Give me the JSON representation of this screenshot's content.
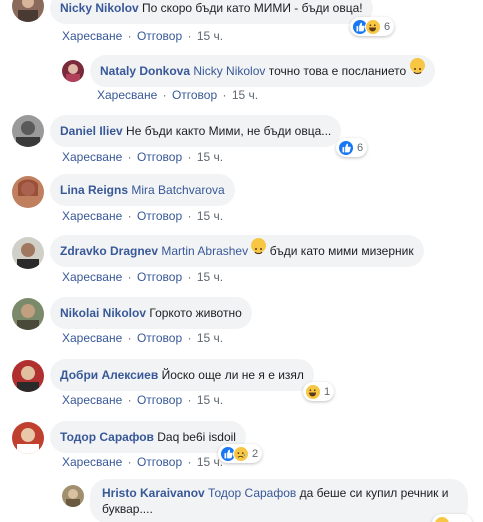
{
  "labels": {
    "like": "Харесване",
    "reply": "Отговор",
    "sep": "·"
  },
  "comments": [
    {
      "author": "Nicky Nikolov",
      "mention": "",
      "text": "По скоро бъди като МИМИ - бъди овца!",
      "time": "15 ч.",
      "reaction_count": "6"
    },
    {
      "author": "Nataly Donkova",
      "mention": "Nicky Nikolov",
      "text": "точно това е посланието",
      "time": "15 ч.",
      "reaction_count": ""
    },
    {
      "author": "Daniel Iliev",
      "mention": "",
      "text": "Не бъди както Мими, не бъди овца...",
      "time": "15 ч.",
      "reaction_count": "6"
    },
    {
      "author": "Lina Reigns",
      "mention": "Mira Batchvarova",
      "text": "",
      "time": "15 ч.",
      "reaction_count": ""
    },
    {
      "author": "Zdravko Dragnev",
      "mention": "Martin Abrashev",
      "text": "бъди като мими мизерник",
      "time": "15 ч.",
      "reaction_count": ""
    },
    {
      "author": "Nikolai Nikolov",
      "mention": "",
      "text": "Горкото животно",
      "time": "15 ч.",
      "reaction_count": ""
    },
    {
      "author": "Добри Алексиев",
      "mention": "",
      "text": "Йоско още ли не я е изял",
      "time": "15 ч.",
      "reaction_count": "1"
    },
    {
      "author": "Тодор Сарафов",
      "mention": "",
      "text": "Daq be6i isdoil",
      "time": "15 ч.",
      "reaction_count": "2"
    },
    {
      "author": "Hristo Karaivanov",
      "mention": "Тодор Сарафов",
      "text": "да беше си купил речник и буквар....",
      "time": "",
      "reaction_count": ""
    }
  ],
  "colors": {
    "author": "#385898",
    "bubble": "#f2f3f5",
    "like_blue": "#1877f2",
    "haha_yellow": "#f7c744",
    "sad_yellow": "#f7c744"
  }
}
